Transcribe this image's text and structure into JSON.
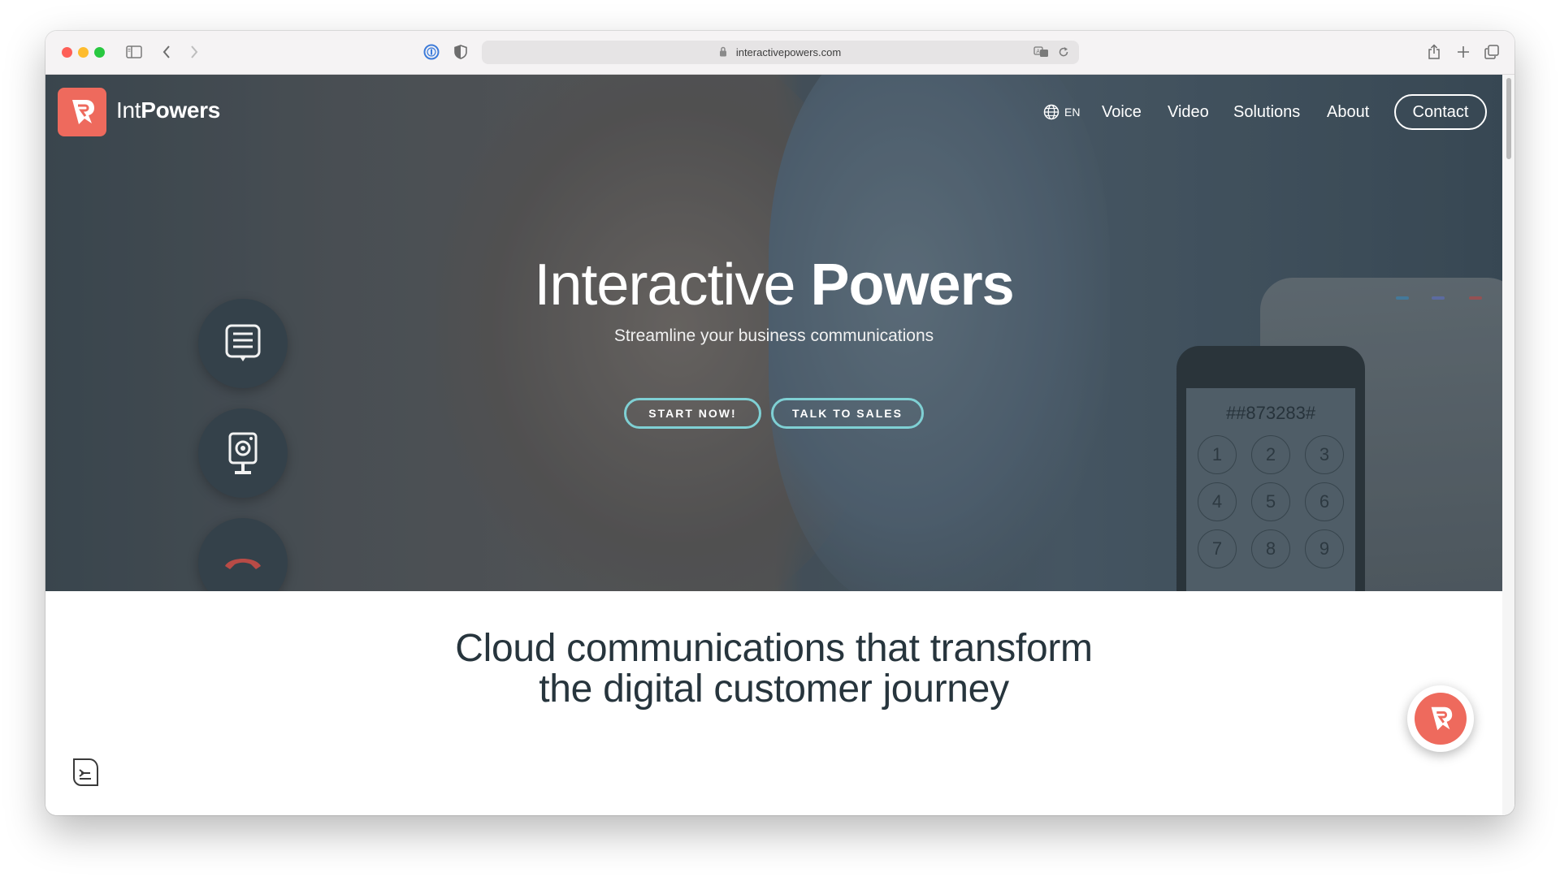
{
  "browser": {
    "url": "interactivepowers.com",
    "icons": [
      "sidebar-icon",
      "back-icon",
      "forward-icon",
      "password-icon",
      "shield-icon",
      "lock-icon",
      "translate-icon",
      "reload-icon",
      "share-icon",
      "plus-icon",
      "tabs-icon"
    ]
  },
  "header": {
    "logo_light": "Int",
    "logo_bold": "Powers",
    "language": "EN",
    "nav": [
      "Voice",
      "Video",
      "Solutions",
      "About"
    ],
    "contact": "Contact"
  },
  "hero": {
    "title_light": "Interactive ",
    "title_bold": "Powers",
    "subtitle": "Streamline your business communications",
    "start_button": "START NOW!",
    "sales_button": "TALK TO SALES",
    "phone_number": "##873283#",
    "keypad": [
      "1",
      "2",
      "3",
      "4",
      "5",
      "6",
      "7",
      "8",
      "9"
    ]
  },
  "section": {
    "headline_line1": "Cloud communications that transform",
    "headline_line2": "the digital customer journey"
  },
  "colors": {
    "brand": "#ee6a5d",
    "accent": "#7fd0d4",
    "heading": "#27353d"
  }
}
